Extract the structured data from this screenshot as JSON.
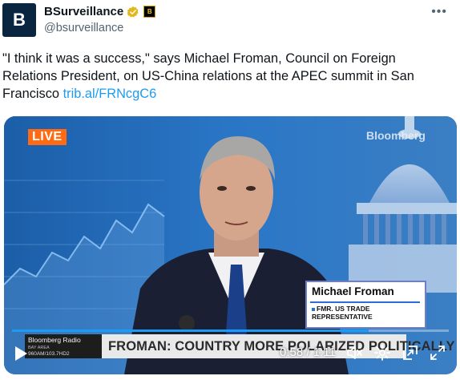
{
  "account": {
    "avatar_letter": "B",
    "display_name": "BSurveillance",
    "handle": "@bsurveillance",
    "affiliation_badge": "B",
    "verified_color": "#e2b719"
  },
  "tweet": {
    "text": "\"I think it was a success,\" says Michael Froman, Council on Foreign Relations President, on US-China relations at the APEC summit in San Francisco ",
    "link": "trib.al/FRNcgC6"
  },
  "video": {
    "live_badge": "LIVE",
    "channel_brand": "Bloomberg",
    "nameplate": {
      "name": "Michael Froman",
      "title_line1": "FMR. US TRADE",
      "title_line2": "REPRESENTATIVE"
    },
    "radio": {
      "line1": "Bloomberg Radio",
      "line2": "BAY AREA",
      "line3": "960AM/103.7HD2"
    },
    "headline": "FROMAN: COUNTRY MORE POLARIZED POLITICALLY",
    "time_display": "0:58 / 1:11",
    "progress_fraction": 0.817
  },
  "icons": [
    "more-icon",
    "verified-icon",
    "play-icon",
    "mute-icon",
    "settings-icon",
    "pip-icon",
    "fullscreen-icon"
  ],
  "colors": {
    "accent": "#1d9bf0",
    "live_orange": "#ff6a13",
    "nameplate_border": "#6f7fc0"
  }
}
